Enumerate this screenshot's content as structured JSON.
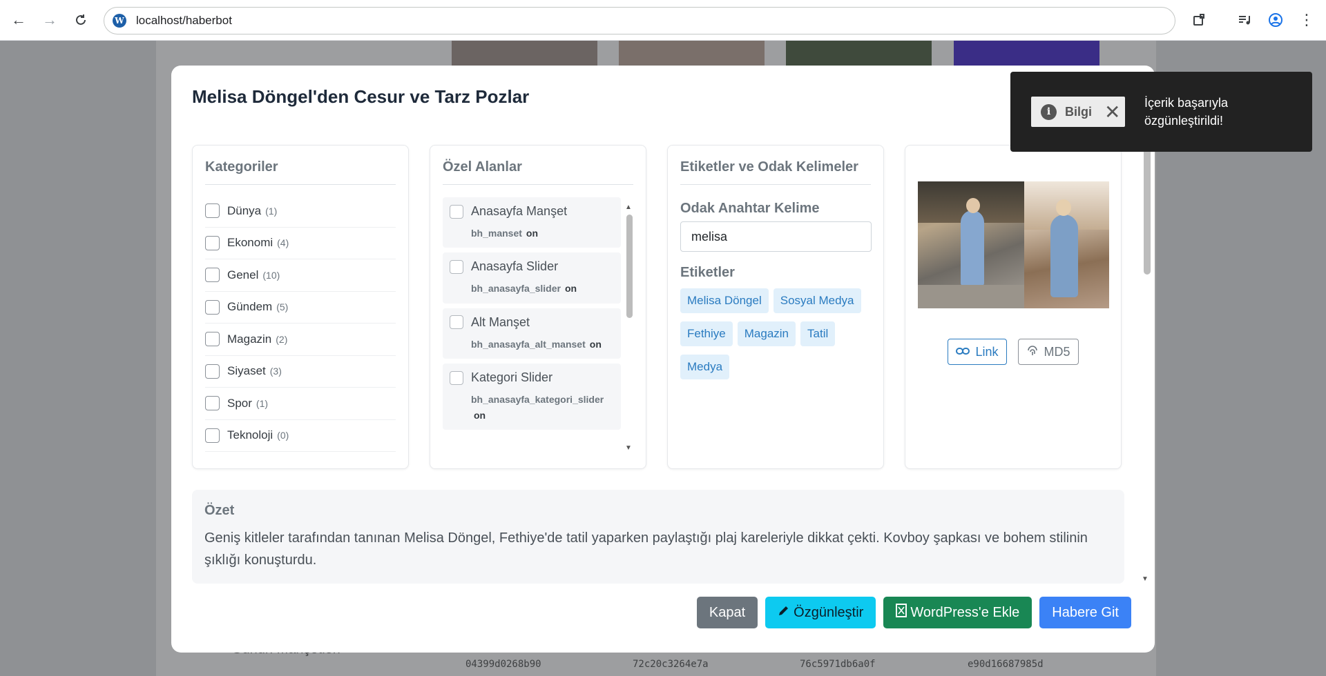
{
  "browser": {
    "url": "localhost/haberbot"
  },
  "background": {
    "bottom_label": "Günün Manşetleri",
    "hashes": [
      "04399d0268b90",
      "72c20c3264e7a",
      "76c5971db6a0f",
      "e90d16687985d"
    ]
  },
  "modal": {
    "title": "Melisa Döngel'den Cesur ve Tarz Pozlar",
    "categories": {
      "title": "Kategoriler",
      "items": [
        {
          "label": "Dünya",
          "count": "(1)"
        },
        {
          "label": "Ekonomi",
          "count": "(4)"
        },
        {
          "label": "Genel",
          "count": "(10)"
        },
        {
          "label": "Gündem",
          "count": "(5)"
        },
        {
          "label": "Magazin",
          "count": "(2)"
        },
        {
          "label": "Siyaset",
          "count": "(3)"
        },
        {
          "label": "Spor",
          "count": "(1)"
        },
        {
          "label": "Teknoloji",
          "count": "(0)"
        }
      ]
    },
    "custom_fields": {
      "title": "Özel Alanlar",
      "items": [
        {
          "label": "Anasayfa Manşet",
          "key": "bh_manset",
          "value": "on"
        },
        {
          "label": "Anasayfa Slider",
          "key": "bh_anasayfa_slider",
          "value": "on"
        },
        {
          "label": "Alt Manşet",
          "key": "bh_anasayfa_alt_manset",
          "value": "on"
        },
        {
          "label": "Kategori Slider",
          "key": "bh_anasayfa_kategori_slider",
          "value": "on"
        }
      ]
    },
    "tags_panel": {
      "title": "Etiketler ve Odak Kelimeler",
      "focus_label": "Odak Anahtar Kelime",
      "focus_value": "melisa",
      "tags_label": "Etiketler",
      "tags": [
        "Melisa Döngel",
        "Sosyal Medya",
        "Fethiye",
        "Magazin",
        "Tatil",
        "Medya"
      ]
    },
    "image_panel": {
      "link_label": "Link",
      "md5_label": "MD5"
    },
    "summary": {
      "title": "Özet",
      "text": "Geniş kitleler tarafından tanınan Melisa Döngel, Fethiye'de tatil yaparken paylaştığı plaj kareleriyle dikkat çekti. Kovboy şapkası ve bohem stilinin şıklığı konuşturdu."
    },
    "buttons": {
      "close": "Kapat",
      "unique": "Özgünleştir",
      "wordpress": "WordPress'e Ekle",
      "go": "Habere Git"
    }
  },
  "toast": {
    "header": "Bilgi",
    "message": "İçerik başarıyla özgünleştirildi!"
  },
  "colors": {
    "accent_blue": "#3b82f6",
    "info_cyan": "#0dcaf0",
    "success_green": "#198754",
    "secondary_gray": "#6c757d",
    "tag_bg": "#e1f0fb"
  }
}
